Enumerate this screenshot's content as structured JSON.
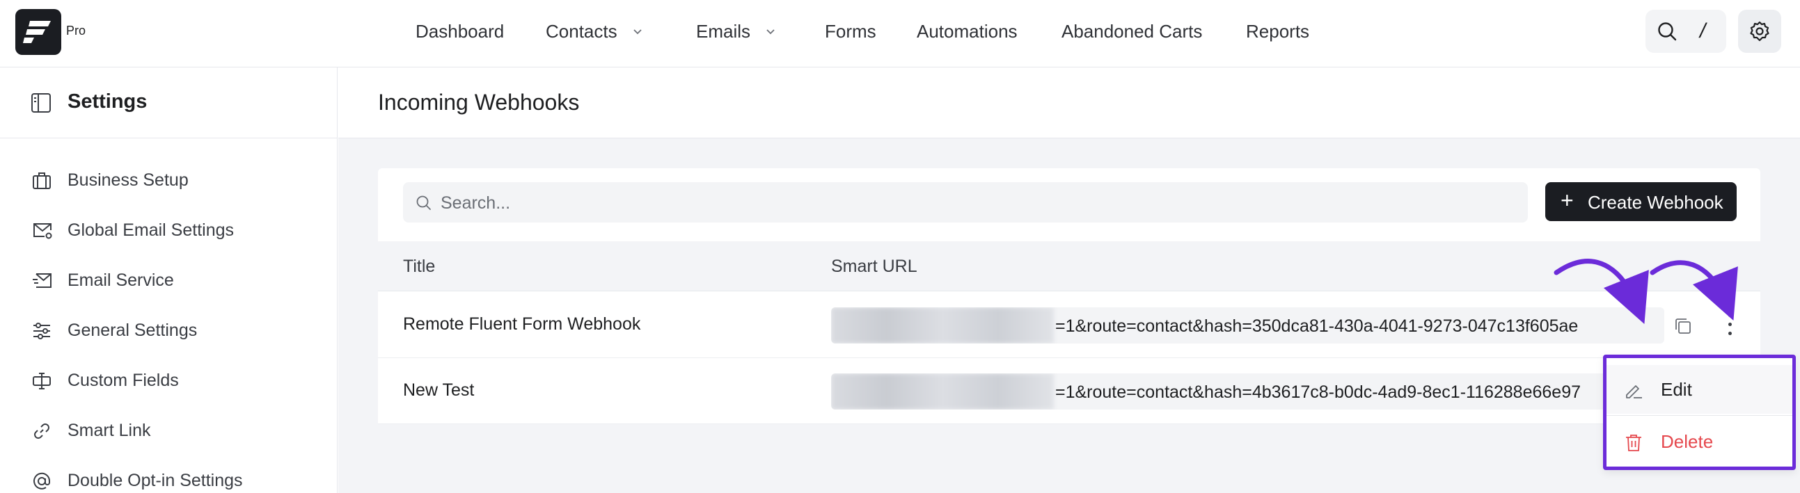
{
  "brand": {
    "pro_label": "Pro",
    "logo_icon": "fluentcrm-logo-icon"
  },
  "nav": {
    "items": [
      {
        "label": "Dashboard",
        "has_dropdown": false
      },
      {
        "label": "Contacts",
        "has_dropdown": true
      },
      {
        "label": "Emails",
        "has_dropdown": true
      },
      {
        "label": "Forms",
        "has_dropdown": false
      },
      {
        "label": "Automations",
        "has_dropdown": false
      },
      {
        "label": "Abandoned Carts",
        "has_dropdown": false
      },
      {
        "label": "Reports",
        "has_dropdown": false
      }
    ],
    "search_shortcut": "/",
    "search_icon": "search-icon",
    "settings_icon": "gear-icon"
  },
  "sidebar": {
    "title": "Settings",
    "title_icon": "sidebar-panel-icon",
    "items": [
      {
        "label": "Business Setup",
        "icon": "briefcase-icon"
      },
      {
        "label": "Global Email Settings",
        "icon": "mail-settings-icon"
      },
      {
        "label": "Email Service",
        "icon": "mail-send-icon"
      },
      {
        "label": "General Settings",
        "icon": "sliders-icon"
      },
      {
        "label": "Custom Fields",
        "icon": "text-cursor-icon"
      },
      {
        "label": "Smart Link",
        "icon": "link-icon"
      },
      {
        "label": "Double Opt-in Settings",
        "icon": "at-sign-icon"
      }
    ]
  },
  "main": {
    "title": "Incoming Webhooks",
    "search": {
      "placeholder": "Search..."
    },
    "create_button": {
      "label": "Create Webhook"
    },
    "table": {
      "columns": [
        "Title",
        "Smart URL"
      ],
      "rows": [
        {
          "title": "Remote Fluent Form Webhook",
          "url_visible": "=1&route=contact&hash=350dca81-430a-4041-9273-047c13f605ae"
        },
        {
          "title": "New Test",
          "url_visible": "=1&route=contact&hash=4b3617c8-b0dc-4ad9-8ec1-116288e66e97"
        }
      ]
    },
    "row_menu": {
      "items": [
        {
          "label": "Edit",
          "icon": "pencil-icon"
        },
        {
          "label": "Delete",
          "icon": "trash-icon"
        }
      ]
    }
  },
  "colors": {
    "accent_dark": "#1b1d22",
    "highlight": "#6b2bd9",
    "danger": "#e5484d",
    "background": "#f3f4f7"
  }
}
